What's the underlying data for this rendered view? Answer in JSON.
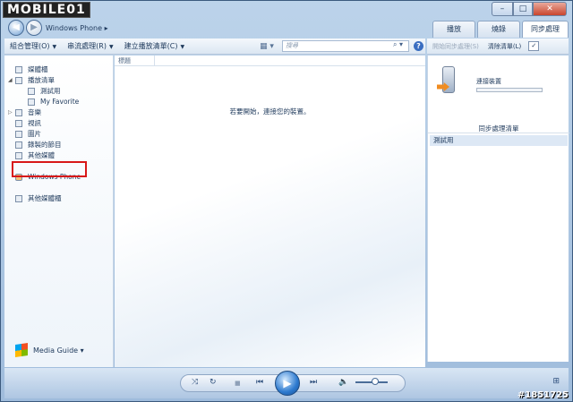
{
  "logo": {
    "text": "MOBILE01"
  },
  "window_controls": {
    "minimize": "–",
    "maximize": "□",
    "close": "✕"
  },
  "nav": {
    "back": "◀",
    "forward": "▶",
    "breadcrumb": "Windows Phone  ▸"
  },
  "tabs": [
    {
      "label": "播放",
      "active": false
    },
    {
      "label": "燒錄",
      "active": false
    },
    {
      "label": "同步處理",
      "active": true
    }
  ],
  "toolbar": {
    "organize": "組合管理(O)",
    "stream": "串流處理(R)",
    "create_playlist": "建立播放清單(C)",
    "search_placeholder": "搜尋",
    "help": "?"
  },
  "sync_toolbar": {
    "start_sync": "開始同步處理(S)",
    "clear_list": "清除清單(L)",
    "options": "✓"
  },
  "sidebar": {
    "items": [
      {
        "label": "媒體櫃",
        "indent": 0,
        "arrow": ""
      },
      {
        "label": "播放清單",
        "indent": 0,
        "arrow": "◢"
      },
      {
        "label": "測試用",
        "indent": 1,
        "arrow": ""
      },
      {
        "label": "My Favorite",
        "indent": 1,
        "arrow": ""
      },
      {
        "label": "音樂",
        "indent": 0,
        "arrow": "▷"
      },
      {
        "label": "視訊",
        "indent": 0,
        "arrow": ""
      },
      {
        "label": "圖片",
        "indent": 0,
        "arrow": ""
      },
      {
        "label": "錄製的節目",
        "indent": 0,
        "arrow": ""
      },
      {
        "label": "其他媒體",
        "indent": 0,
        "arrow": ""
      },
      {
        "label": "Windows Phone",
        "indent": 0,
        "arrow": ""
      },
      {
        "label": "其他媒體櫃",
        "indent": 0,
        "arrow": ""
      }
    ],
    "media_guide": "Media Guide  ▾"
  },
  "content": {
    "column_title": "標題",
    "hint": "若要開始，連接您的裝置。"
  },
  "sync_pane": {
    "connect_label": "連接裝置",
    "sync_list_title": "同步處理清單",
    "sync_list_items": [
      "測試用"
    ]
  },
  "player": {
    "shuffle": "⤨",
    "repeat": "↻",
    "stop": "■",
    "prev": "⏮",
    "play": "▶",
    "next": "⏭",
    "volume": "🔈",
    "switch_view": "⊞"
  },
  "watermark": "#1851725",
  "colors": {
    "accent": "#2c79cf",
    "highlight_border": "#d81818"
  }
}
